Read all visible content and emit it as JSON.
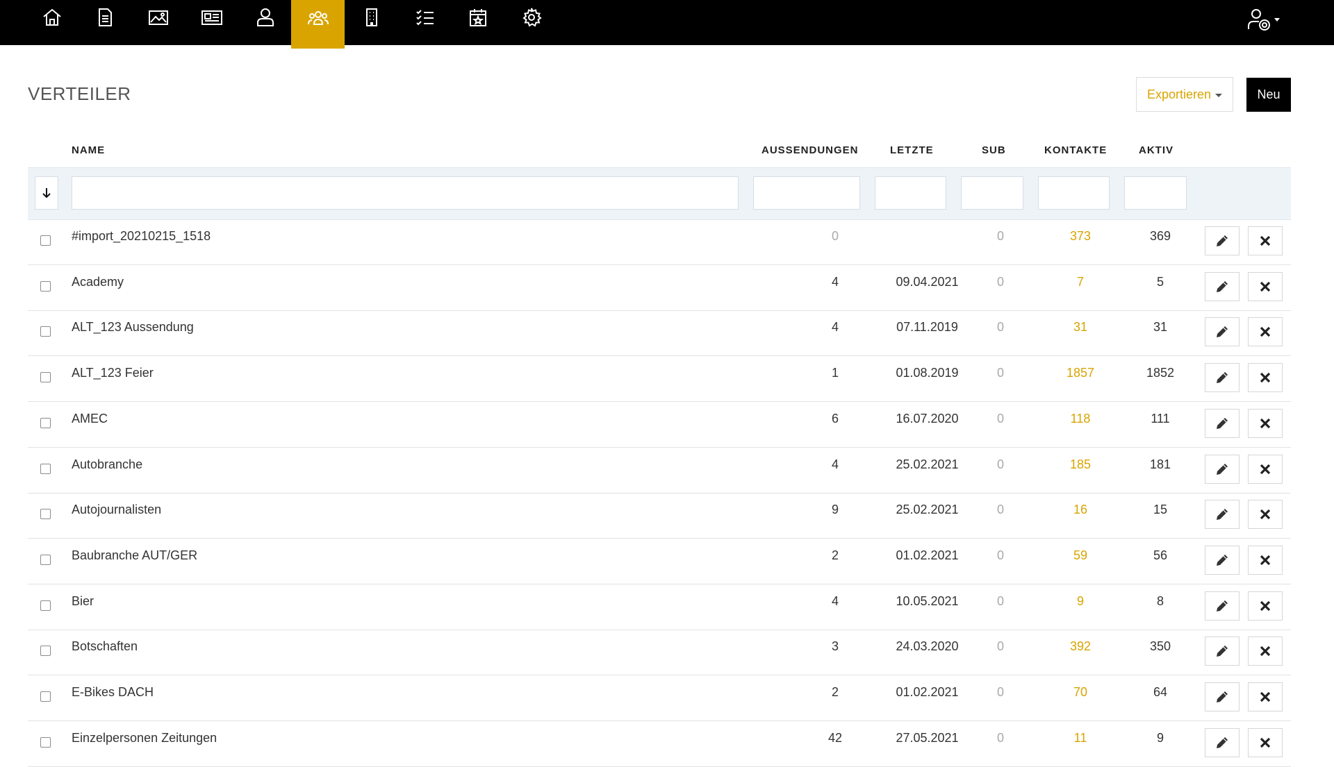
{
  "nav": {
    "items": [
      {
        "icon": "home-icon"
      },
      {
        "icon": "document-icon"
      },
      {
        "icon": "image-icon"
      },
      {
        "icon": "newspaper-icon"
      },
      {
        "icon": "user-icon"
      },
      {
        "icon": "users-group-icon",
        "active": true
      },
      {
        "icon": "building-icon"
      },
      {
        "icon": "checklist-icon"
      },
      {
        "icon": "calendar-star-icon"
      },
      {
        "icon": "gear-icon"
      }
    ],
    "user_menu_icon": "user-settings-icon",
    "active_color": "#d9a400"
  },
  "page": {
    "title": "VERTEILER",
    "export_label": "Exportieren",
    "new_label": "Neu"
  },
  "table": {
    "headers": {
      "name": "NAME",
      "aussendungen": "AUSSENDUNGEN",
      "letzte": "LETZTE",
      "sub": "SUB",
      "kontakte": "KONTAKTE",
      "aktiv": "AKTIV"
    },
    "rows": [
      {
        "name": "#import_20210215_1518",
        "aussendungen": "0",
        "letzte": "",
        "sub": "0",
        "kontakte": "373",
        "aktiv": "369"
      },
      {
        "name": "Academy",
        "aussendungen": "4",
        "letzte": "09.04.2021",
        "sub": "0",
        "kontakte": "7",
        "aktiv": "5"
      },
      {
        "name": "ALT_123 Aussendung",
        "aussendungen": "4",
        "letzte": "07.11.2019",
        "sub": "0",
        "kontakte": "31",
        "aktiv": "31"
      },
      {
        "name": "ALT_123 Feier",
        "aussendungen": "1",
        "letzte": "01.08.2019",
        "sub": "0",
        "kontakte": "1857",
        "aktiv": "1852"
      },
      {
        "name": "AMEC",
        "aussendungen": "6",
        "letzte": "16.07.2020",
        "sub": "0",
        "kontakte": "118",
        "aktiv": "111"
      },
      {
        "name": "Autobranche",
        "aussendungen": "4",
        "letzte": "25.02.2021",
        "sub": "0",
        "kontakte": "185",
        "aktiv": "181"
      },
      {
        "name": "Autojournalisten",
        "aussendungen": "9",
        "letzte": "25.02.2021",
        "sub": "0",
        "kontakte": "16",
        "aktiv": "15"
      },
      {
        "name": "Baubranche AUT/GER",
        "aussendungen": "2",
        "letzte": "01.02.2021",
        "sub": "0",
        "kontakte": "59",
        "aktiv": "56"
      },
      {
        "name": "Bier",
        "aussendungen": "4",
        "letzte": "10.05.2021",
        "sub": "0",
        "kontakte": "9",
        "aktiv": "8"
      },
      {
        "name": "Botschaften",
        "aussendungen": "3",
        "letzte": "24.03.2020",
        "sub": "0",
        "kontakte": "392",
        "aktiv": "350"
      },
      {
        "name": "E-Bikes DACH",
        "aussendungen": "2",
        "letzte": "01.02.2021",
        "sub": "0",
        "kontakte": "70",
        "aktiv": "64"
      },
      {
        "name": "Einzelpersonen Zeitungen",
        "aussendungen": "42",
        "letzte": "27.05.2021",
        "sub": "0",
        "kontakte": "11",
        "aktiv": "9"
      }
    ],
    "edit_icon": "pencil-icon",
    "delete_icon": "close-icon",
    "sort_icon": "arrow-down-icon"
  },
  "colors": {
    "accent": "#d9a400",
    "topbar": "#000000",
    "filter_bg": "#eef3f8"
  }
}
